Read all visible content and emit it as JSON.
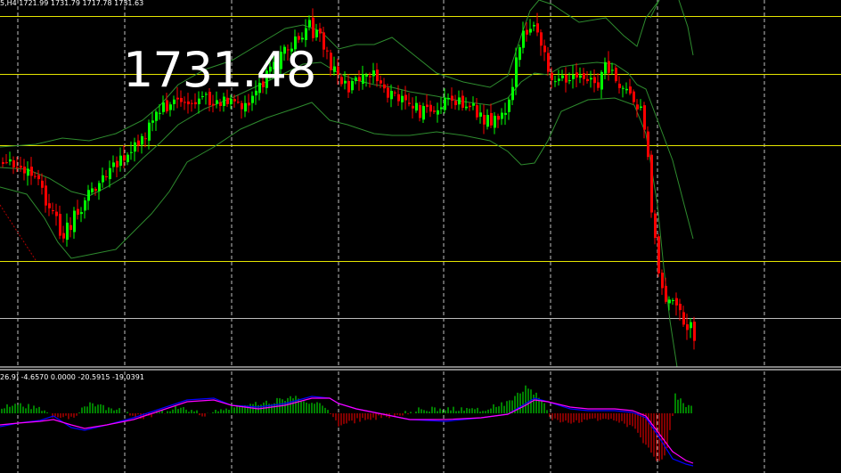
{
  "main_chart": {
    "header": "5,H4  1721.99 1731.79 1717.78 1731.63",
    "big_price": "1731.48"
  },
  "sub_chart": {
    "header": "26.9) -4.6570 0.0000 -20.5915 -19.0391"
  },
  "colors": {
    "background": "#000000",
    "bull": "#00ff00",
    "bear": "#ff0000",
    "bollinger": "#2e8b2e",
    "level": "#e6e600",
    "separator": "#ffffff",
    "macd_fast": "#0000ff",
    "macd_signal": "#ff00ff"
  },
  "chart_data": [
    {
      "type": "candlestick",
      "title": "",
      "indicator": "Bollinger Bands",
      "horizontal_levels": [
        {
          "name": "level-1",
          "value": 3
        },
        {
          "name": "level-2",
          "value": 2
        },
        {
          "name": "level-3",
          "value": 1
        },
        {
          "name": "level-4",
          "value": 0
        },
        {
          "name": "level-5",
          "value": -1
        }
      ],
      "vertical_grid": true,
      "candles_close_estimate": [
        1718,
        1724,
        1712,
        1700,
        1690,
        1705,
        1722,
        1735,
        1760,
        1790,
        1805,
        1798,
        1770,
        1756,
        1748,
        1752,
        1738,
        1744,
        1760,
        1792,
        1808,
        1792,
        1776,
        1770,
        1745,
        1665,
        1635,
        1628,
        1620
      ]
    },
    {
      "type": "bar",
      "title": "",
      "indicator": "MACD histogram with signal lines",
      "values_estimate": [
        3,
        4,
        2,
        -2,
        1,
        4,
        6,
        5,
        4,
        3,
        3,
        2,
        -1,
        -3,
        -1,
        0,
        1,
        2,
        4,
        6,
        9,
        6,
        2,
        0,
        -1,
        -4,
        -8,
        6,
        8
      ]
    }
  ]
}
